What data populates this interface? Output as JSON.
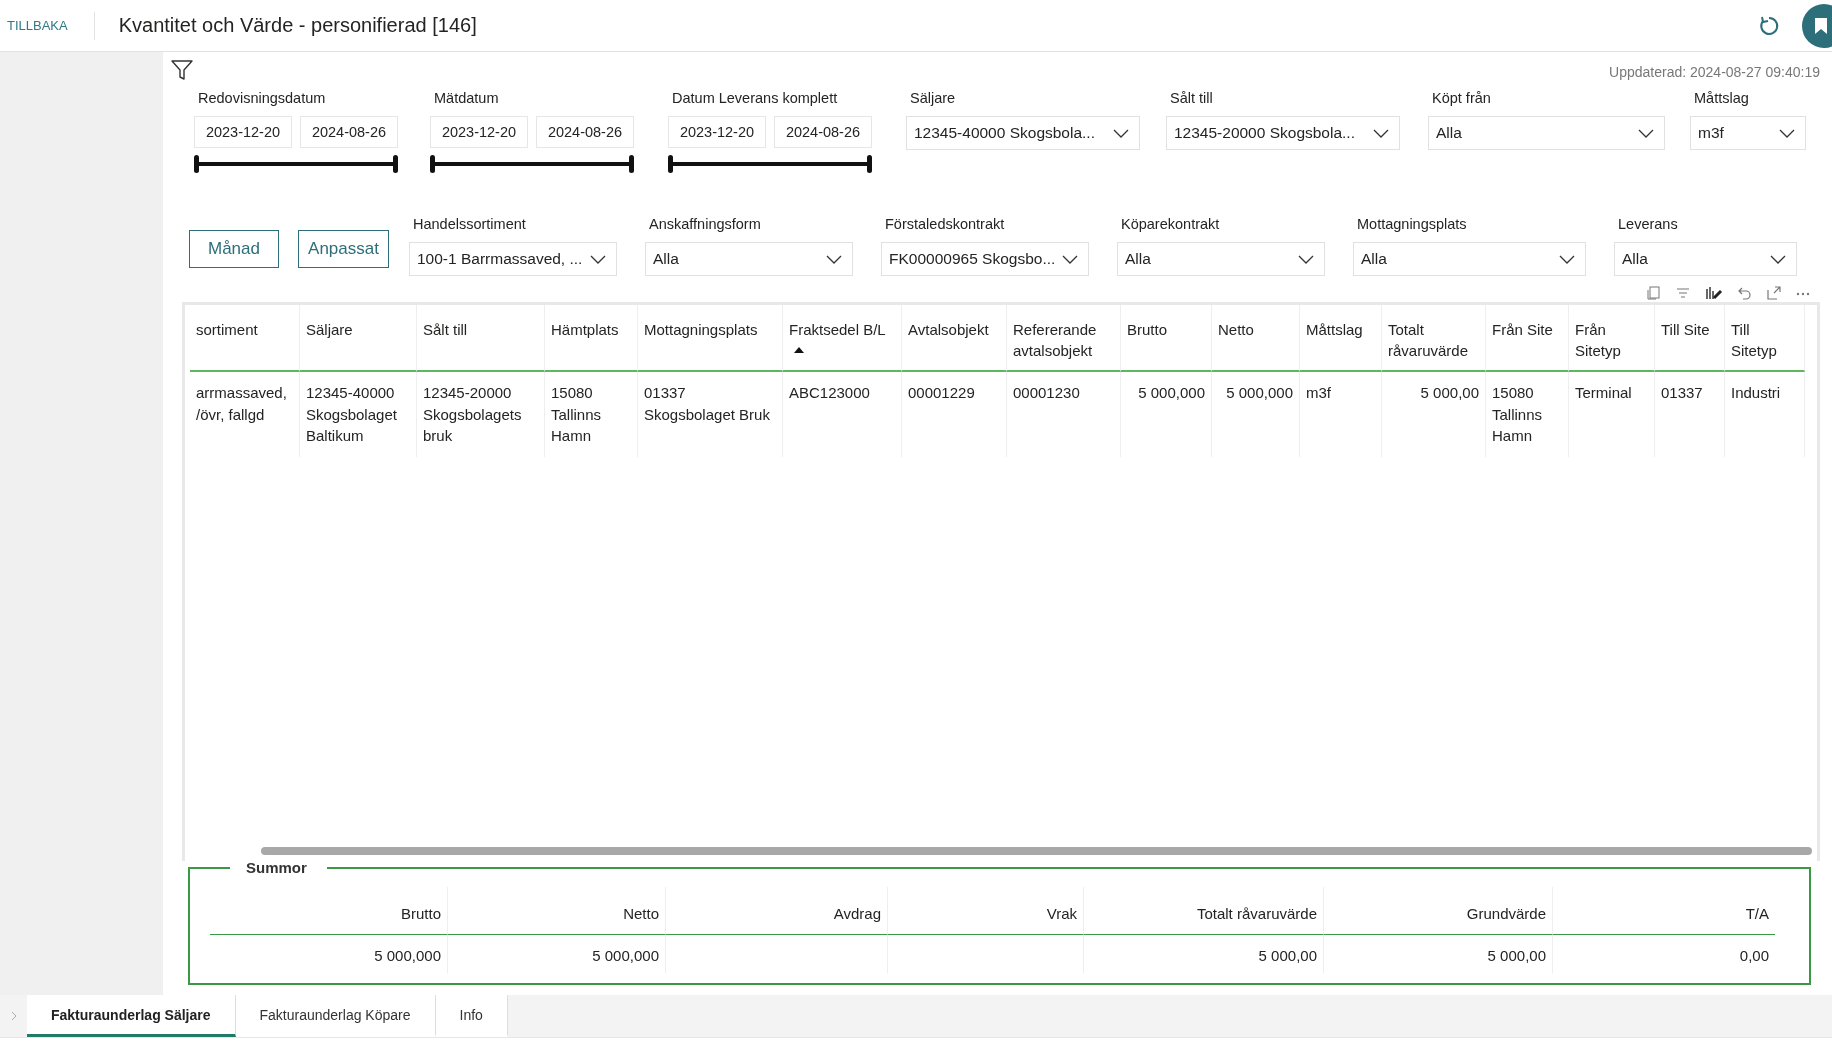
{
  "header": {
    "back_link": "TILLBAKA",
    "title": "Kvantitet och Värde - personifierad [146]"
  },
  "updated": "Uppdaterad: 2024-08-27 09:40:19",
  "filters_row1": [
    {
      "kind": "date-range",
      "label": "Redovisningsdatum",
      "from": "2023-12-20",
      "to": "2024-08-26",
      "level": 1
    },
    {
      "kind": "date-range",
      "label": "Mätdatum",
      "from": "2023-12-20",
      "to": "2024-08-26",
      "level": 1
    },
    {
      "kind": "date-range",
      "label": "Datum Leverans komplett",
      "from": "2023-12-20",
      "to": "2024-08-26",
      "level": 1
    },
    {
      "kind": "dropdown",
      "label": "Säljare",
      "value": "12345-40000 Skogsbola..."
    },
    {
      "kind": "dropdown",
      "label": "Sålt till",
      "value": "12345-20000 Skogsbola..."
    },
    {
      "kind": "dropdown",
      "label": "Köpt från",
      "value": "Alla"
    },
    {
      "kind": "dropdown",
      "label": "Måttslag",
      "value": "m3f"
    }
  ],
  "period_buttons": [
    "Månad",
    "Anpassat"
  ],
  "filters_row2": [
    {
      "kind": "dropdown",
      "label": "Handelssortiment",
      "value": "100-1 Barrmassaved, ..."
    },
    {
      "kind": "dropdown",
      "label": "Anskaffningsform",
      "value": "Alla"
    },
    {
      "kind": "dropdown",
      "label": "Förstaledskontrakt",
      "value": "FK00000965 Skogsbo..."
    },
    {
      "kind": "dropdown",
      "label": "Köparekontrakt",
      "value": "Alla"
    },
    {
      "kind": "dropdown",
      "label": "Mottagningsplats",
      "value": "Alla"
    },
    {
      "kind": "dropdown",
      "label": "Leverans",
      "value": "Alla"
    }
  ],
  "table": {
    "columns": [
      {
        "label": "sortiment",
        "kind": "text",
        "sorted": false
      },
      {
        "label": "Säljare",
        "kind": "text",
        "sorted": false
      },
      {
        "label": "Sålt till",
        "kind": "text",
        "sorted": false
      },
      {
        "label": "Hämtplats",
        "kind": "text",
        "sorted": false
      },
      {
        "label": "Mottagningsplats",
        "kind": "text",
        "sorted": false
      },
      {
        "label": "Fraktsedel B/L",
        "kind": "text",
        "sorted": true
      },
      {
        "label": "Avtalsobjekt",
        "kind": "text",
        "sorted": false
      },
      {
        "label": "Refererande avtalsobjekt",
        "kind": "text",
        "sorted": false
      },
      {
        "label": "Brutto",
        "kind": "number",
        "sorted": false
      },
      {
        "label": "Netto",
        "kind": "number",
        "sorted": false
      },
      {
        "label": "Måttslag",
        "kind": "text",
        "sorted": false
      },
      {
        "label": "Totalt råvaruvärde",
        "kind": "number",
        "sorted": false
      },
      {
        "label": "Från Site",
        "kind": "text",
        "sorted": false
      },
      {
        "label": "Från Sitetyp",
        "kind": "text",
        "sorted": false
      },
      {
        "label": "Till Site",
        "kind": "text",
        "sorted": false
      },
      {
        "label": "Till Sitetyp",
        "kind": "text",
        "sorted": false
      }
    ],
    "rows": [
      [
        "arrmassaved, /övr, fallgd",
        "12345-40000 Skogsbolaget Baltikum",
        "12345-20000 Skogsbolagets bruk",
        "15080 Tallinns Hamn",
        "01337 Skogsbolaget Bruk",
        "ABC123000",
        "00001229",
        "00001230",
        "5 000,000",
        "5 000,000",
        "m3f",
        "5 000,00",
        "15080 Tallinns Hamn",
        "Terminal",
        "01337",
        "Industri"
      ]
    ]
  },
  "summary": {
    "title": "Summor",
    "columns": [
      {
        "label": "Brutto",
        "value": "5 000,000"
      },
      {
        "label": "Netto",
        "value": "5 000,000"
      },
      {
        "label": "Avdrag"
      },
      {
        "label": "Vrak"
      },
      {
        "label": "Totalt råvaruvärde",
        "value": "5 000,00"
      },
      {
        "label": "Grundvärde",
        "value": "5 000,00"
      },
      {
        "label": "T/A",
        "value": "0,00"
      }
    ]
  },
  "bottom_tabs": [
    {
      "label": "Fakturaunderlag Säljare",
      "selected": true
    },
    {
      "label": "Fakturaunderlag Köpare",
      "selected": false
    },
    {
      "label": "Info",
      "selected": false
    }
  ]
}
